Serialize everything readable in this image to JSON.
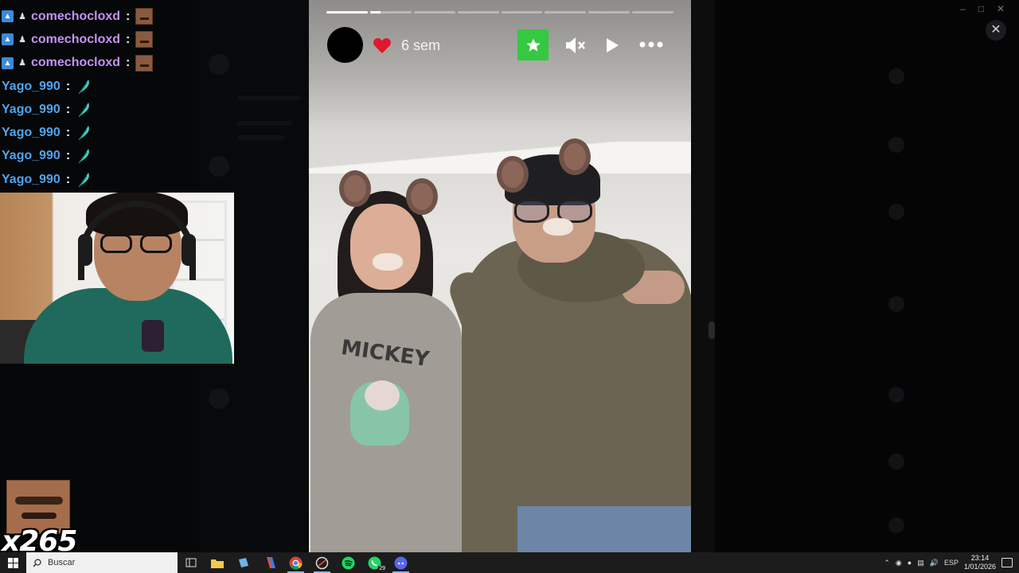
{
  "chat": {
    "messages": [
      {
        "user": "comechocloxd",
        "type": "emote-face"
      },
      {
        "user": "comechocloxd",
        "type": "emote-face"
      },
      {
        "user": "comechocloxd",
        "type": "emote-face"
      },
      {
        "user": "Yago_990",
        "type": "emote-leaf"
      },
      {
        "user": "Yago_990",
        "type": "emote-leaf"
      },
      {
        "user": "Yago_990",
        "type": "emote-leaf"
      },
      {
        "user": "Yago_990",
        "type": "emote-leaf"
      },
      {
        "user": "Yago_990",
        "type": "emote-leaf"
      }
    ],
    "separator": ":"
  },
  "combo": {
    "count": "x265"
  },
  "story": {
    "age": "6 sem",
    "progress": {
      "segments": 8,
      "current_index": 1,
      "current_fill": 0.25
    },
    "icons": {
      "avatar": "avatar",
      "like": "heart-icon",
      "favorite": "star-icon",
      "mute": "mute-icon",
      "play": "play-icon",
      "more": "more-icon"
    },
    "shirt_print": "MICKEY"
  },
  "colors": {
    "chat_user_purple": "#c493f7",
    "chat_user_blue": "#4fa6f0",
    "star_green": "#35c840",
    "heart_red": "#e0182d"
  },
  "taskbar": {
    "search_placeholder": "Buscar",
    "apps": [
      "task-view-icon",
      "file-explorer-icon",
      "notes-icon",
      "app-icon",
      "chrome-icon",
      "app-icon",
      "spotify-icon",
      "whatsapp-icon",
      "discord-icon"
    ],
    "whatsapp_badge": "29",
    "language": "ESP",
    "time": "23:14",
    "date": "1/01/2026"
  }
}
